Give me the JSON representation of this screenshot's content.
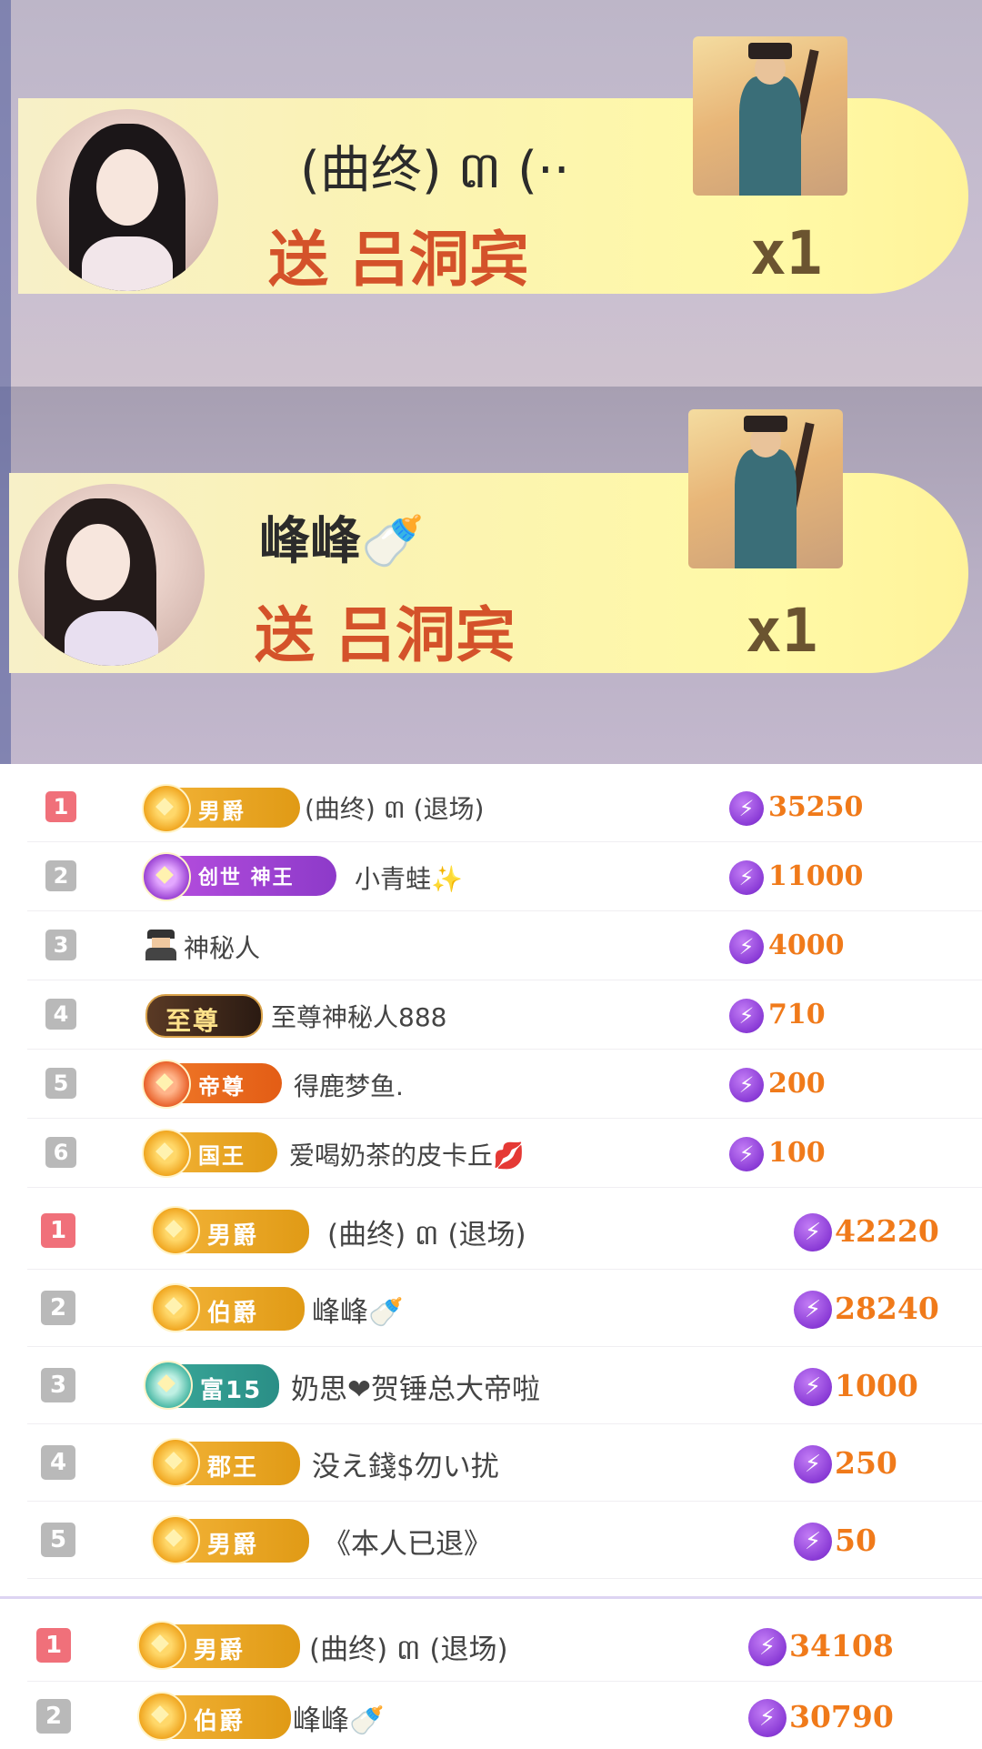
{
  "gift_banners": [
    {
      "sender": "(曲终) ៣ (··",
      "action": "送 吕洞宾",
      "count": "x1",
      "gift_icon": "lv-dongbin-gift-icon"
    },
    {
      "sender": "峰峰🍼",
      "action": "送 吕洞宾",
      "count": "x1",
      "gift_icon": "lv-dongbin-gift-icon"
    }
  ],
  "boards": [
    {
      "rows": [
        {
          "rank": "1",
          "badge": "男爵",
          "name": "(曲终) ៣ (退场)",
          "score": "35250"
        },
        {
          "rank": "2",
          "badge": "创世 神王",
          "name": "小青蛙✨",
          "score": "11000"
        },
        {
          "rank": "3",
          "badge": "",
          "name": "神秘人",
          "score": "4000"
        },
        {
          "rank": "4",
          "badge": "至尊",
          "name": "至尊神秘人888",
          "score": "710"
        },
        {
          "rank": "5",
          "badge": "帝尊",
          "name": "得鹿梦鱼.",
          "score": "200"
        },
        {
          "rank": "6",
          "badge": "国王",
          "name": "爱喝奶茶的皮卡丘💋",
          "score": "100"
        }
      ]
    },
    {
      "rows": [
        {
          "rank": "1",
          "badge": "男爵",
          "name": "(曲终) ៣ (退场)",
          "score": "42220"
        },
        {
          "rank": "2",
          "badge": "伯爵",
          "name": "峰峰🍼",
          "score": "28240"
        },
        {
          "rank": "3",
          "badge": "富15",
          "name": "奶思❤贺锤总大帝啦",
          "score": "1000"
        },
        {
          "rank": "4",
          "badge": "郡王",
          "name": "没え錢$勿い扰",
          "score": "250"
        },
        {
          "rank": "5",
          "badge": "男爵",
          "name": "《本人已退》",
          "score": "50"
        }
      ]
    },
    {
      "rows": [
        {
          "rank": "1",
          "badge": "男爵",
          "name": "(曲终) ៣ (退场)",
          "score": "34108"
        },
        {
          "rank": "2",
          "badge": "伯爵",
          "name": "峰峰🍼",
          "score": "30790"
        }
      ]
    }
  ],
  "colors": {
    "score": "#f07a1a",
    "rank_first": "#f0707a",
    "rank_other": "#b9b9b9",
    "action": "#d4522a"
  }
}
